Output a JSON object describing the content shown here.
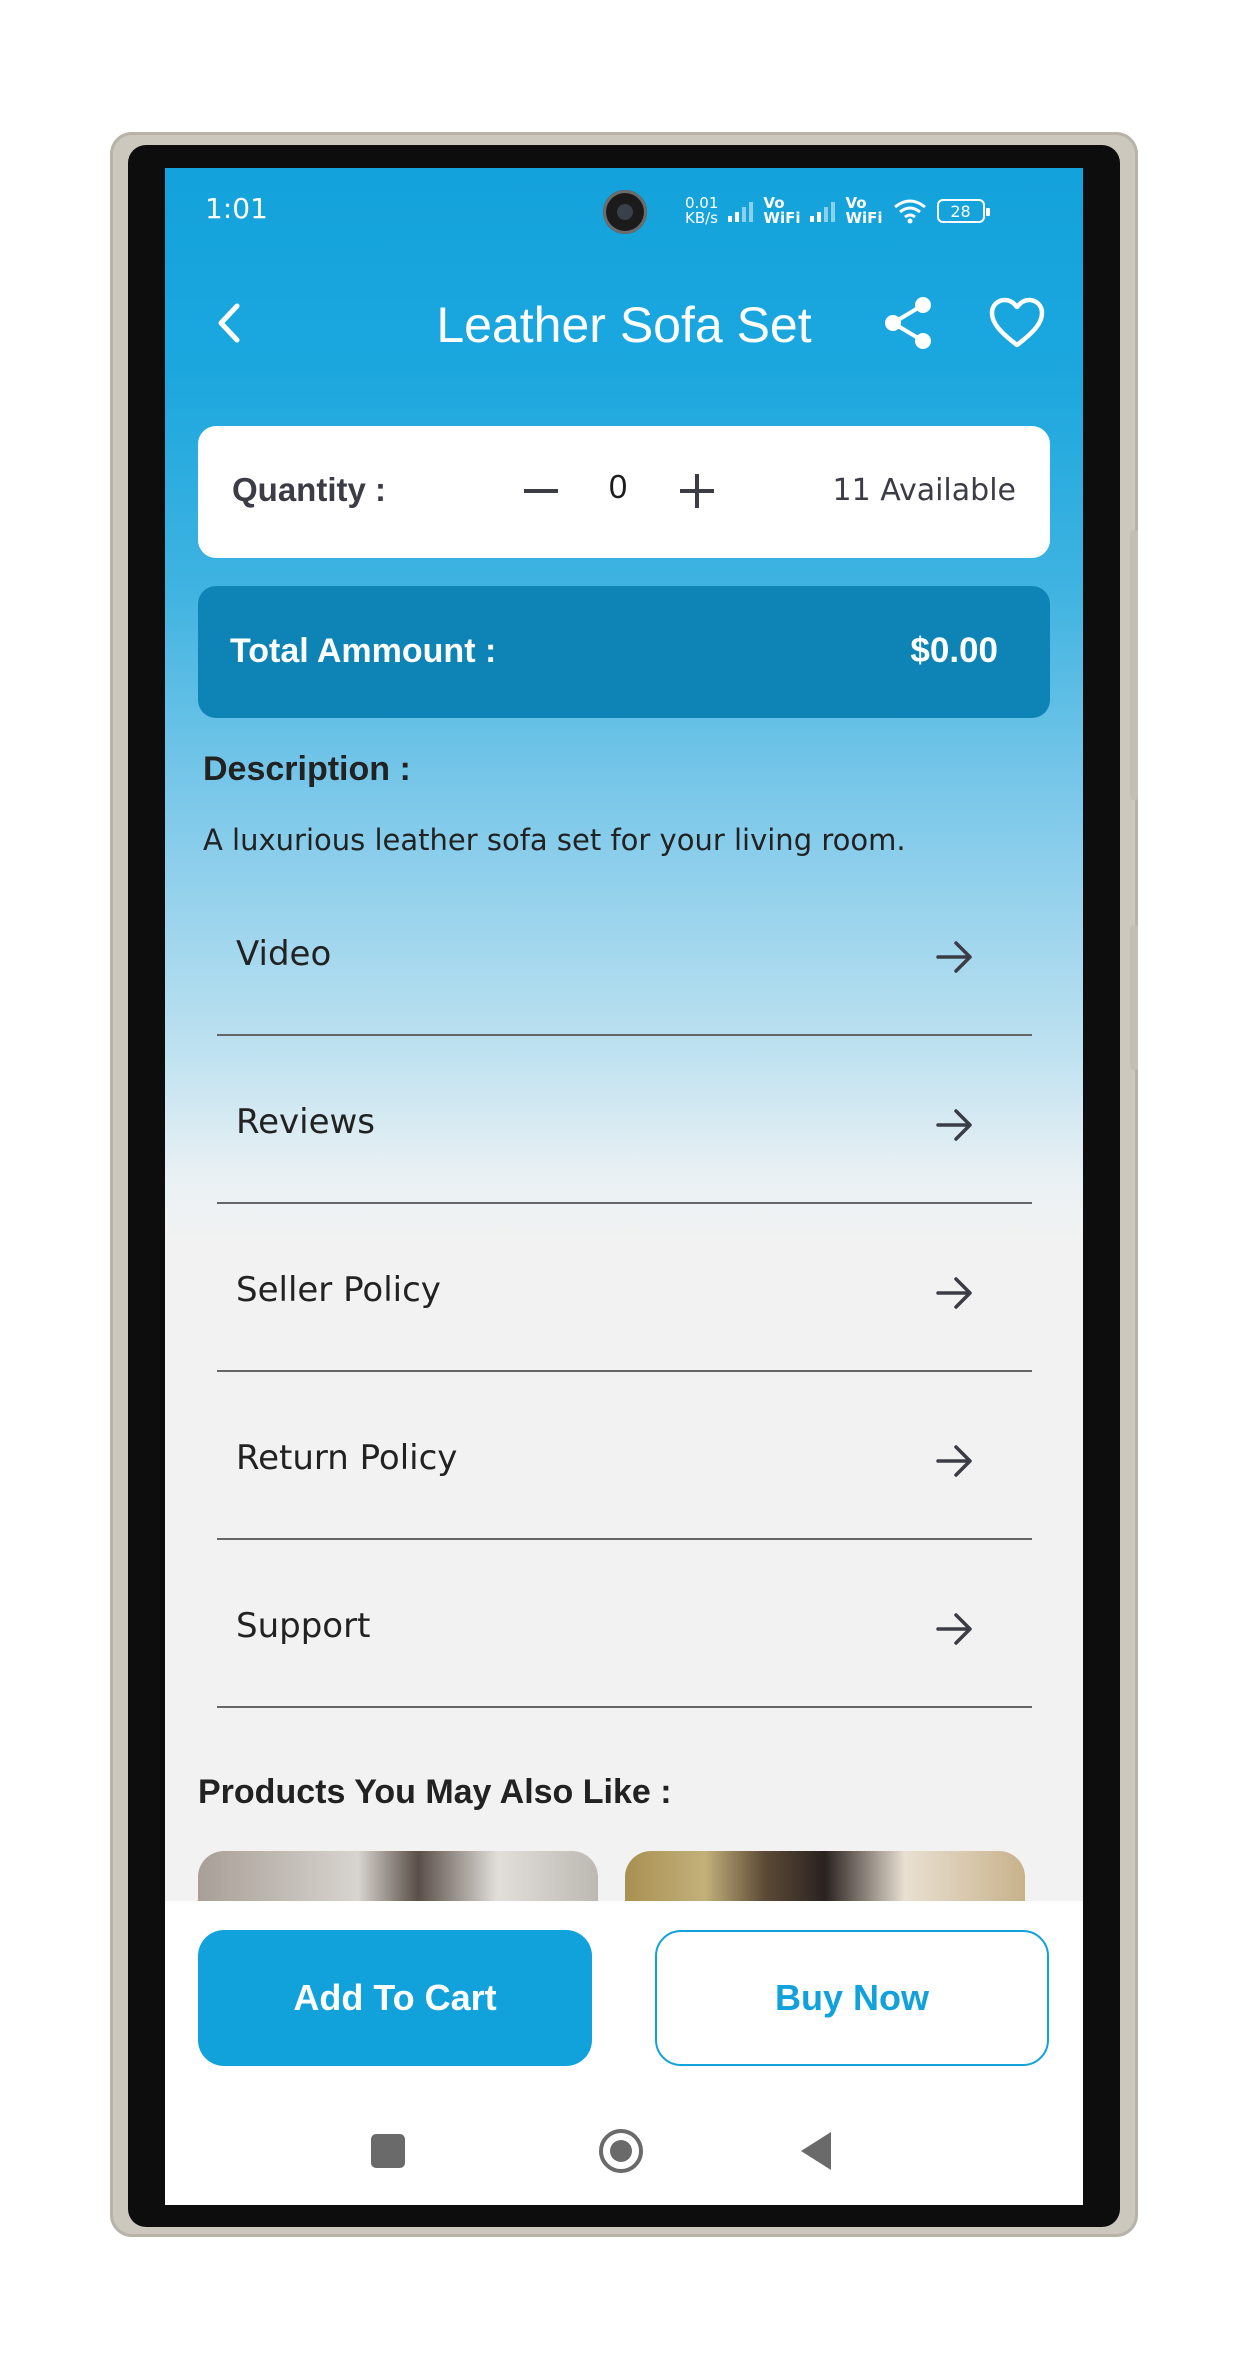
{
  "status_bar": {
    "time": "1:01",
    "net_speed_value": "0.01",
    "net_speed_unit": "KB/s",
    "sim1": [
      "Vo",
      "WiFi"
    ],
    "sim2": [
      "Vo",
      "WiFi"
    ],
    "battery": "28"
  },
  "app_bar": {
    "title": "Leather Sofa Set",
    "back_icon": "chevron-left-icon",
    "share_icon": "share-icon",
    "favorite_icon": "heart-outline-icon"
  },
  "quantity": {
    "label": "Quantity :",
    "value": "0",
    "available": "11 Available"
  },
  "total": {
    "label": "Total Ammount :",
    "value": "$0.00"
  },
  "description": {
    "title": "Description :",
    "text": "A luxurious leather sofa set for your living room."
  },
  "menu_items": [
    {
      "label": "Video"
    },
    {
      "label": "Reviews"
    },
    {
      "label": "Seller Policy"
    },
    {
      "label": "Return Policy"
    },
    {
      "label": "Support"
    }
  ],
  "also_like": {
    "title": "Products You May Also Like :"
  },
  "actions": {
    "add_to_cart": "Add To Cart",
    "buy_now": "Buy Now"
  },
  "colors": {
    "primary": "#11a2dc",
    "total_card": "#0d84b5",
    "background": "#f2f2f2"
  }
}
